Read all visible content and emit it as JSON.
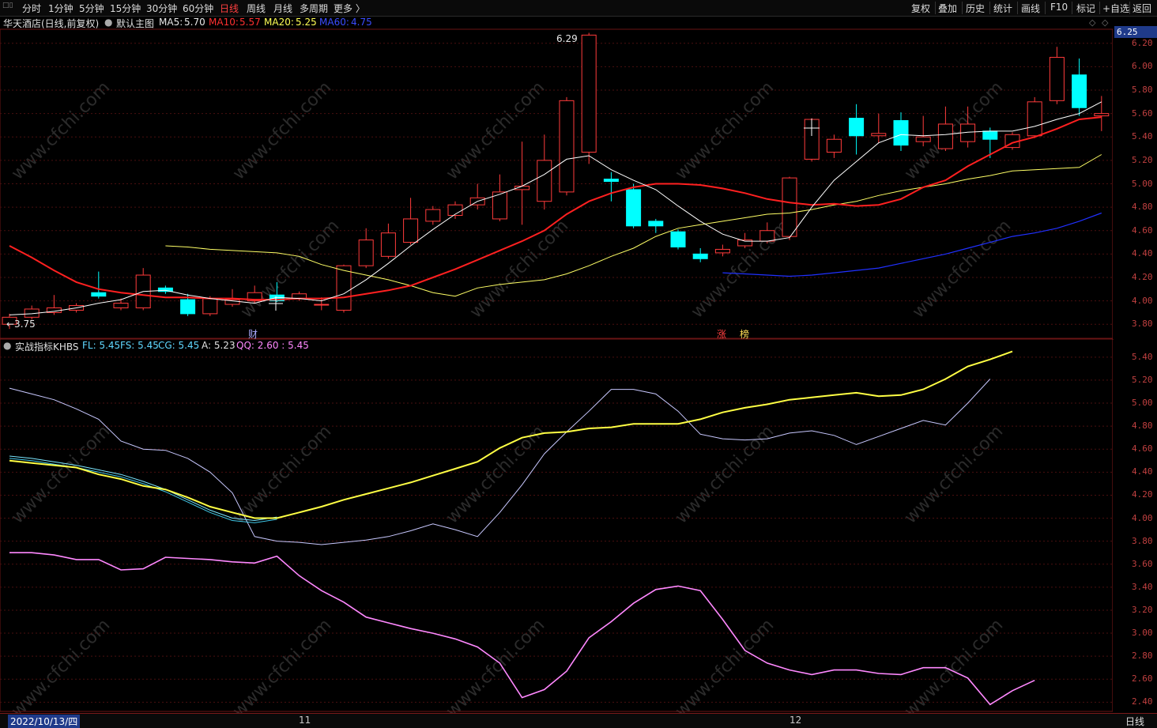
{
  "toolbar": {
    "logo": "分时",
    "periods": [
      "分时",
      "1分钟",
      "5分钟",
      "15分钟",
      "30分钟",
      "60分钟",
      "日线",
      "周线",
      "月线",
      "多周期",
      "更多 〉"
    ],
    "active_period": "日线",
    "right_buttons": [
      "复权",
      "叠加",
      "历史",
      "统计",
      "画线",
      "F10",
      "标记",
      "+自选",
      "返回"
    ]
  },
  "main_header": {
    "stock": "华天酒店(日线,前复权)",
    "template": "默认主图",
    "ma5_label": "MA5:",
    "ma5_value": "5.70",
    "ma10_label": "MA10:",
    "ma10_value": "5.57",
    "ma20_label": "MA20:",
    "ma20_value": "5.25",
    "ma60_label": "MA60:",
    "ma60_value": "4.75"
  },
  "price_axis": {
    "current_price": "6.25",
    "labels": [
      "6.20",
      "6.00",
      "5.80",
      "5.60",
      "5.40",
      "5.20",
      "5.00",
      "4.80",
      "4.60",
      "4.40",
      "4.20",
      "4.00",
      "3.80"
    ]
  },
  "annotations": {
    "high_label": "6.29",
    "low_label": "←3.75",
    "event_cai": "财",
    "event_zhang": "涨",
    "event_bang": "榜"
  },
  "sub_header": {
    "indicator": "实战指标KHBS",
    "fl": "FL: 5.45",
    "fs": "FS: 5.45",
    "cg": "CG: 5.45",
    "a": "A: 5.23",
    "qq": "QQ: 2.60 : 5.45"
  },
  "sub_axis": {
    "labels": [
      "5.40",
      "5.20",
      "5.00",
      "4.80",
      "4.60",
      "4.40",
      "4.20",
      "4.00",
      "3.80",
      "3.60",
      "3.40",
      "3.20",
      "3.00",
      "2.80",
      "2.60",
      "2.40"
    ]
  },
  "bottom_bar": {
    "date": "2022/10/13/四",
    "month_11": "11",
    "month_12": "12",
    "period": "日线"
  },
  "watermark": "www.cfchi.com",
  "colors": {
    "up": "#ff3b3b",
    "down": "#00ffff",
    "ma5": "#ffffff",
    "ma10": "#ff2020",
    "ma20": "#ffff66",
    "ma60": "#2030ff",
    "qq": "#ff88ff",
    "a_line": "#c8c8ff"
  },
  "chart_data": {
    "type": "candlestick",
    "price_range": [
      3.68,
      6.32
    ],
    "candles": [
      [
        3.8,
        3.86,
        3.76,
        3.89
      ],
      [
        3.86,
        3.93,
        3.84,
        3.96
      ],
      [
        3.9,
        3.94,
        3.88,
        4.05
      ],
      [
        3.92,
        3.96,
        3.9,
        3.98
      ],
      [
        4.07,
        4.04,
        4.02,
        4.25
      ],
      [
        3.94,
        3.98,
        3.92,
        4.02
      ],
      [
        3.94,
        4.22,
        3.92,
        4.28
      ],
      [
        4.11,
        4.08,
        4.06,
        4.13
      ],
      [
        4.01,
        3.89,
        3.87,
        4.06
      ],
      [
        3.89,
        4.02,
        3.87,
        4.04
      ],
      [
        3.97,
        4.01,
        3.95,
        4.1
      ],
      [
        4.0,
        4.07,
        3.98,
        4.13
      ],
      [
        4.05,
        4.0,
        3.99,
        4.16
      ],
      [
        4.02,
        4.06,
        4.0,
        4.08
      ],
      [
        3.97,
        3.97,
        3.92,
        4.03
      ],
      [
        3.92,
        4.3,
        3.9,
        4.31
      ],
      [
        4.3,
        4.52,
        4.28,
        4.62
      ],
      [
        4.38,
        4.58,
        4.36,
        4.66
      ],
      [
        4.5,
        4.7,
        4.48,
        4.88
      ],
      [
        4.68,
        4.78,
        4.65,
        4.81
      ],
      [
        4.73,
        4.82,
        4.7,
        4.85
      ],
      [
        4.82,
        4.88,
        4.78,
        5.0
      ],
      [
        4.7,
        4.93,
        4.68,
        5.08
      ],
      [
        4.95,
        4.98,
        4.65,
        5.36
      ],
      [
        4.85,
        5.2,
        4.78,
        5.42
      ],
      [
        4.93,
        5.71,
        4.9,
        5.74
      ],
      [
        5.27,
        6.27,
        5.17,
        6.29
      ],
      [
        5.04,
        5.02,
        4.85,
        5.1
      ],
      [
        4.95,
        4.64,
        4.62,
        5.0
      ],
      [
        4.68,
        4.64,
        4.58,
        4.7
      ],
      [
        4.59,
        4.46,
        4.44,
        4.61
      ],
      [
        4.4,
        4.36,
        4.33,
        4.45
      ],
      [
        4.41,
        4.44,
        4.38,
        4.48
      ],
      [
        4.47,
        4.52,
        4.45,
        4.58
      ],
      [
        4.51,
        4.6,
        4.49,
        4.67
      ],
      [
        4.55,
        5.05,
        4.52,
        5.06
      ],
      [
        5.21,
        5.55,
        5.19,
        5.56
      ],
      [
        5.27,
        5.38,
        5.22,
        5.42
      ],
      [
        5.56,
        5.41,
        5.25,
        5.68
      ],
      [
        5.41,
        5.43,
        5.35,
        5.6
      ],
      [
        5.54,
        5.33,
        5.28,
        5.61
      ],
      [
        5.36,
        5.4,
        5.32,
        5.58
      ],
      [
        5.3,
        5.51,
        5.28,
        5.66
      ],
      [
        5.36,
        5.51,
        5.31,
        5.66
      ],
      [
        5.45,
        5.38,
        5.22,
        5.48
      ],
      [
        5.31,
        5.42,
        5.29,
        5.44
      ],
      [
        5.41,
        5.7,
        5.39,
        5.74
      ],
      [
        5.71,
        6.08,
        5.68,
        6.17
      ],
      [
        5.93,
        5.65,
        5.58,
        6.07
      ],
      [
        5.58,
        5.6,
        5.45,
        5.75
      ]
    ],
    "ma5": [
      3.88,
      3.89,
      3.91,
      3.94,
      3.98,
      4.01,
      4.08,
      4.09,
      4.05,
      4.02,
      4.0,
      3.98,
      4.03,
      4.02,
      4.0,
      4.06,
      4.18,
      4.32,
      4.47,
      4.61,
      4.74,
      4.85,
      4.91,
      4.98,
      5.08,
      5.21,
      5.24,
      5.12,
      5.03,
      4.95,
      4.81,
      4.68,
      4.57,
      4.51,
      4.51,
      4.54,
      4.8,
      5.03,
      5.19,
      5.35,
      5.42,
      5.41,
      5.42,
      5.44,
      5.45,
      5.45,
      5.49,
      5.55,
      5.6,
      5.7
    ],
    "ma10": [
      4.47,
      4.37,
      4.26,
      4.16,
      4.1,
      4.07,
      4.05,
      4.03,
      4.03,
      4.02,
      4.02,
      4.01,
      4.01,
      4.02,
      4.02,
      4.03,
      4.06,
      4.09,
      4.13,
      4.2,
      4.27,
      4.35,
      4.43,
      4.51,
      4.6,
      4.74,
      4.85,
      4.92,
      4.97,
      5.0,
      5.0,
      4.99,
      4.96,
      4.92,
      4.87,
      4.84,
      4.82,
      4.83,
      4.81,
      4.82,
      4.87,
      4.97,
      5.03,
      5.15,
      5.25,
      5.35,
      5.4,
      5.47,
      5.55,
      5.57
    ],
    "ma20": [
      4.47,
      4.46,
      4.44,
      4.43,
      4.42,
      4.41,
      4.38,
      4.31,
      4.26,
      4.22,
      4.18,
      4.13,
      4.07,
      4.04,
      4.11,
      4.14,
      4.16,
      4.18,
      4.23,
      4.3,
      4.38,
      4.45,
      4.55,
      4.62,
      4.65,
      4.68,
      4.71,
      4.74,
      4.75,
      4.78,
      4.82,
      4.85,
      4.9,
      4.94,
      4.97,
      5.0,
      5.04,
      5.07,
      5.11,
      5.12,
      5.13,
      5.14,
      5.25
    ],
    "ma20_start": 7,
    "ma60": [
      4.24,
      4.23,
      4.22,
      4.21,
      4.22,
      4.24,
      4.26,
      4.28,
      4.32,
      4.36,
      4.4,
      4.45,
      4.5,
      4.55,
      4.58,
      4.62,
      4.68,
      4.75
    ],
    "sub_range": [
      2.32,
      5.55
    ],
    "fl_cg": [
      4.5,
      4.48,
      4.46,
      4.44,
      4.38,
      4.34,
      4.28,
      4.25,
      4.18,
      4.1,
      4.05,
      4.0,
      4.0,
      4.05,
      4.1,
      4.16,
      4.21,
      4.26,
      4.31,
      4.37,
      4.43,
      4.49,
      4.61,
      4.7,
      4.74,
      4.75,
      4.78,
      4.79,
      4.82,
      4.82,
      4.82,
      4.86,
      4.92,
      4.96,
      4.99,
      5.03,
      5.05,
      5.07,
      5.09,
      5.06,
      5.07,
      5.12,
      5.21,
      5.32,
      5.38,
      5.45
    ],
    "fs": [
      4.52,
      4.5,
      4.47,
      4.44,
      4.4,
      4.36,
      4.3,
      4.23,
      4.14,
      4.05,
      3.98,
      3.96,
      3.99
    ],
    "a_line": [
      5.13,
      5.08,
      5.03,
      4.95,
      4.86,
      4.67,
      4.6,
      4.59,
      4.52,
      4.4,
      4.22,
      3.84,
      3.8,
      3.79,
      3.77,
      3.79,
      3.81,
      3.84,
      3.89,
      3.95,
      3.9,
      3.84,
      4.05,
      4.29,
      4.56,
      4.75,
      4.93,
      5.12,
      5.12,
      5.08,
      4.93,
      4.73,
      4.69,
      4.68,
      4.69,
      4.74,
      4.76,
      4.72,
      4.64,
      4.71,
      4.78,
      4.85,
      4.81,
      5.0,
      5.21
    ],
    "qq": [
      3.7,
      3.7,
      3.68,
      3.64,
      3.64,
      3.55,
      3.56,
      3.66,
      3.65,
      3.64,
      3.62,
      3.61,
      3.67,
      3.5,
      3.37,
      3.27,
      3.14,
      3.09,
      3.04,
      3.0,
      2.95,
      2.88,
      2.74,
      2.44,
      2.51,
      2.67,
      2.96,
      3.1,
      3.26,
      3.38,
      3.41,
      3.37,
      3.12,
      2.85,
      2.74,
      2.68,
      2.64,
      2.68,
      2.68,
      2.65,
      2.64,
      2.7,
      2.7,
      2.61,
      2.38,
      2.5,
      2.59
    ]
  }
}
